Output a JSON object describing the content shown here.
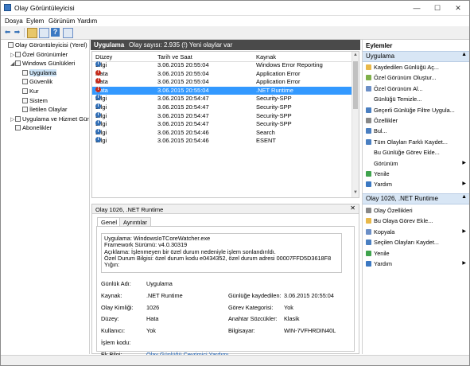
{
  "window": {
    "title": "Olay Görüntüleyicisi",
    "minimize": "—",
    "maximize": "☐",
    "close": "✕"
  },
  "menu": [
    "Dosya",
    "Eylem",
    "Görünüm",
    "Yardım"
  ],
  "tree": [
    {
      "label": "Olay Görüntüleyicisi (Yerel)",
      "level": 0,
      "expander": ""
    },
    {
      "label": "Özel Görünümler",
      "level": 1,
      "expander": "▷"
    },
    {
      "label": "Windows Günlükleri",
      "level": 1,
      "expander": "◢"
    },
    {
      "label": "Uygulama",
      "level": 2,
      "expander": "",
      "selected": true
    },
    {
      "label": "Güvenlik",
      "level": 2,
      "expander": ""
    },
    {
      "label": "Kur",
      "level": 2,
      "expander": ""
    },
    {
      "label": "Sistem",
      "level": 2,
      "expander": ""
    },
    {
      "label": "İletilen Olaylar",
      "level": 2,
      "expander": ""
    },
    {
      "label": "Uygulama ve Hizmet Günlük",
      "level": 1,
      "expander": "▷"
    },
    {
      "label": "Abonelikler",
      "level": 1,
      "expander": ""
    }
  ],
  "center": {
    "log_name": "Uygulama",
    "event_count": "Olay sayısı: 2.935 (!) Yeni olaylar var",
    "columns": [
      "Düzey",
      "Tarih ve Saat",
      "Kaynak"
    ],
    "rows": [
      {
        "level": "Bilgi",
        "kind": "info",
        "date": "3.06.2015 20:55:04",
        "source": "Windows Error Reporting"
      },
      {
        "level": "Hata",
        "kind": "err",
        "date": "3.06.2015 20:55:04",
        "source": "Application Error"
      },
      {
        "level": "Hata",
        "kind": "err",
        "date": "3.06.2015 20:55:04",
        "source": "Application Error"
      },
      {
        "level": "Hata",
        "kind": "err",
        "date": "3.06.2015 20:55:04",
        "source": ".NET Runtime",
        "selected": true
      },
      {
        "level": "Bilgi",
        "kind": "info",
        "date": "3.06.2015 20:54:47",
        "source": "Security-SPP"
      },
      {
        "level": "Bilgi",
        "kind": "info",
        "date": "3.06.2015 20:54:47",
        "source": "Security-SPP"
      },
      {
        "level": "Bilgi",
        "kind": "info",
        "date": "3.06.2015 20:54:47",
        "source": "Security-SPP"
      },
      {
        "level": "Bilgi",
        "kind": "info",
        "date": "3.06.2015 20:54:47",
        "source": "Security-SPP"
      },
      {
        "level": "Bilgi",
        "kind": "info",
        "date": "3.06.2015 20:54:46",
        "source": "Search"
      },
      {
        "level": "Bilgi",
        "kind": "info",
        "date": "3.06.2015 20:54:46",
        "source": "ESENT"
      }
    ]
  },
  "detail": {
    "title": "Olay 1026, .NET Runtime",
    "close": "✕",
    "tabs": [
      "Genel",
      "Ayrıntılar"
    ],
    "description": [
      "Uygulama: WindowsIoTCoreWatcher.exe",
      "Framework Sürümü: v4.0.30319",
      "Açıklama: İşlenmeyen bir özel durum nedeniyle işlem sonlandırıldı.",
      "Özel Durum Bilgisi: özel durum kodu e0434352, özel durum adresi 00007FFD5D3618F8",
      "Yığın:"
    ],
    "fields_left": [
      {
        "label": "Günlük Adı:",
        "value": "Uygulama"
      },
      {
        "label": "Kaynak:",
        "value": ".NET Runtime"
      },
      {
        "label": "Olay Kimliği:",
        "value": "1026"
      },
      {
        "label": "Düzey:",
        "value": "Hata"
      },
      {
        "label": "Kullanıcı:",
        "value": "Yok"
      },
      {
        "label": "İşlem kodu:",
        "value": ""
      },
      {
        "label": "Ek Bilgi:",
        "value": "Olay Günlüğü Çevrimiçi Yardımı"
      }
    ],
    "fields_right": [
      {
        "label": "Günlüğe kaydedilen:",
        "value": "3.06.2015 20:55:04"
      },
      {
        "label": "Görev Kategorisi:",
        "value": "Yok"
      },
      {
        "label": "Anahtar Sözcükler:",
        "value": "Klasik"
      },
      {
        "label": "Bilgisayar:",
        "value": "WIN-7VFHRDIN40L"
      }
    ]
  },
  "actions": {
    "title": "Eylemler",
    "section1": "Uygulama",
    "items1": [
      {
        "label": "Kaydedilen Günlüğü Aç...",
        "icon": "#e8b84a",
        "sub": ""
      },
      {
        "label": "Özel Görünüm Oluştur...",
        "icon": "#7fb04a",
        "sub": ""
      },
      {
        "label": "Özel Görünüm Al...",
        "icon": "#6b8fc7",
        "sub": ""
      },
      {
        "label": "Günlüğü Temizle...",
        "icon": "",
        "sub": ""
      },
      {
        "label": "Geçerli Günlüğe Filtre Uygula...",
        "icon": "#4a7fc1",
        "sub": ""
      },
      {
        "label": "Özellikler",
        "icon": "#888888",
        "sub": ""
      },
      {
        "label": "Bul...",
        "icon": "#4a7fc1",
        "sub": ""
      },
      {
        "label": "Tüm Olayları Farklı Kaydet...",
        "icon": "#4a7fc1",
        "sub": ""
      },
      {
        "label": "Bu Günlüğe Görev Ekle...",
        "icon": "",
        "sub": ""
      },
      {
        "label": "Görünüm",
        "icon": "",
        "sub": "▶"
      },
      {
        "label": "Yenile",
        "icon": "#3fa34d",
        "sub": ""
      },
      {
        "label": "Yardım",
        "icon": "#3b78c2",
        "sub": "▶"
      }
    ],
    "section2": "Olay 1026, .NET Runtime",
    "items2": [
      {
        "label": "Olay Özellikleri",
        "icon": "#888888",
        "sub": ""
      },
      {
        "label": "Bu Olaya Görev Ekle...",
        "icon": "#e8b84a",
        "sub": ""
      },
      {
        "label": "Kopyala",
        "icon": "#6b8fc7",
        "sub": "▶"
      },
      {
        "label": "Seçilen Olayları Kaydet...",
        "icon": "#4a7fc1",
        "sub": ""
      },
      {
        "label": "Yenile",
        "icon": "#3fa34d",
        "sub": ""
      },
      {
        "label": "Yardım",
        "icon": "#3b78c2",
        "sub": "▶"
      }
    ],
    "collapse": "▲"
  }
}
